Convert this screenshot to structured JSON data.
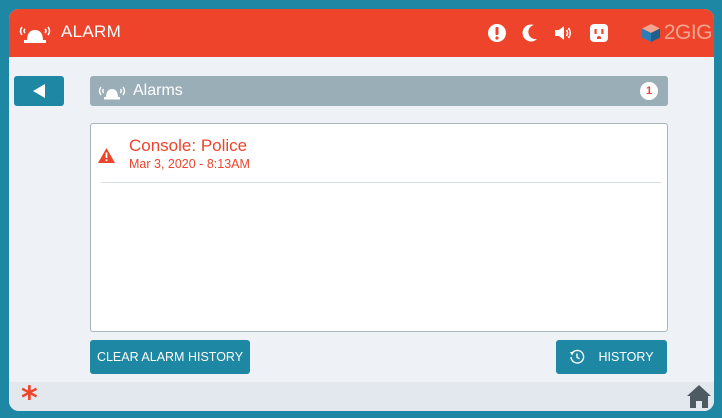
{
  "header": {
    "title": "ALARM",
    "siren_icon": "alarm-siren-icon",
    "status_icons": [
      "alert-icon",
      "night-mode-icon",
      "volume-icon",
      "power-outlet-icon"
    ],
    "brand": "2GIG",
    "colors": {
      "bar": "#ee442c",
      "brand": "#f2a48e"
    }
  },
  "nav": {
    "back_icon": "back-arrow-icon"
  },
  "section": {
    "label": "Alarms",
    "count": "1",
    "color": "#9aaeb8"
  },
  "alarms": [
    {
      "event": "Console: Police",
      "time": "Mar 3, 2020 - 8:13AM",
      "icon": "warning-triangle-icon"
    }
  ],
  "actions": {
    "clear_label": "CLEAR ALARM HISTORY",
    "history_label": "HISTORY",
    "history_icon": "clock-history-icon",
    "color": "#1e87a3"
  },
  "footer": {
    "left_icon": "asterisk-icon",
    "right_icon": "home-icon"
  }
}
